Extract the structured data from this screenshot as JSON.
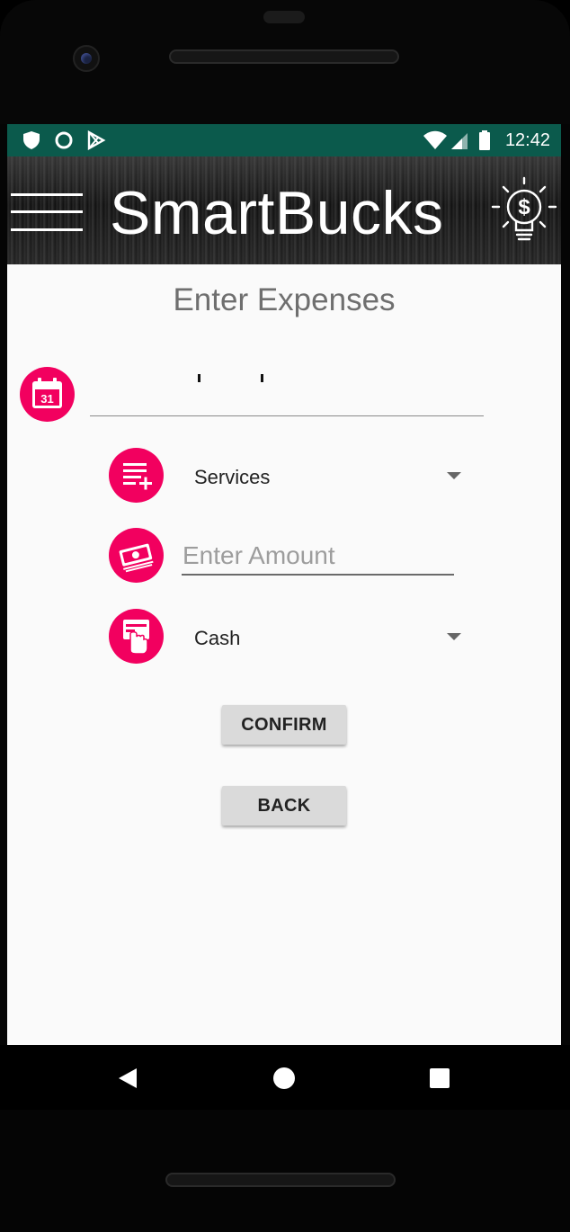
{
  "status_bar": {
    "time": "12:42",
    "left_icons": [
      "shield-icon",
      "circle-icon",
      "play-store-icon"
    ],
    "right_icons": [
      "wifi-icon",
      "signal-icon",
      "battery-icon"
    ],
    "background": "#0b5a4c"
  },
  "app_bar": {
    "title": "SmartBucks",
    "menu_icon": "hamburger-menu-icon",
    "logo_icon": "lightbulb-dollar-icon"
  },
  "form": {
    "heading": "Enter Expenses",
    "date_icon": "calendar-icon",
    "date_icon_text": "31",
    "category_icon": "list-add-icon",
    "category_value": "Services",
    "amount_icon": "cash-icon",
    "amount_placeholder": "Enter Amount",
    "amount_value": "",
    "payment_icon": "card-payment-icon",
    "payment_value": "Cash",
    "confirm_label": "CONFIRM",
    "back_label": "BACK"
  },
  "colors": {
    "accent": "#f2005f",
    "screen_bg": "#fafafa",
    "button_bg": "#dadada"
  },
  "nav_bar": {
    "icons": [
      "back-triangle-icon",
      "home-circle-icon",
      "recents-square-icon"
    ]
  }
}
